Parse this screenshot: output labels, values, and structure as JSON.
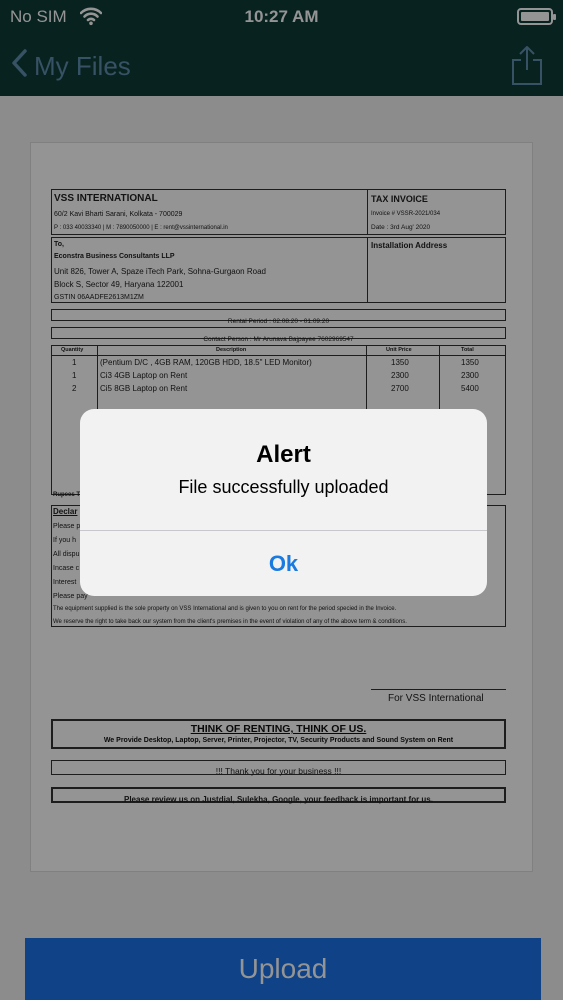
{
  "status_bar": {
    "carrier": "No SIM",
    "time": "10:27 AM"
  },
  "nav": {
    "back_label": "My Files"
  },
  "invoice": {
    "company": "VSS INTERNATIONAL",
    "company_address": "60/2 Kavi Bharti Sarani, Kolkata - 700029",
    "company_contact": "P : 033 40033340 | M : 7890050000 | E : rent@vssinternational.in",
    "doc_type": "TAX INVOICE",
    "invoice_no": "Invoice # VSSR-2021/034",
    "date": "Date : 3rd Aug' 2020",
    "to_label": "To,",
    "client_name": "Econstra Business Consultants LLP",
    "client_address_1": "Unit 826, Tower A, Spaze iTech Park, Sohna-Gurgaon Road",
    "client_address_2": "Block S, Sector 49, Haryana 122001",
    "client_gstin": "GSTIN 06AADFE2613M1ZM",
    "installation_label": "Installation Address",
    "rental_period": "Rental Period : 02.08.20 - 01.09.20",
    "contact_person": "Contact Person : Mr Arunava Bajpayee 7602969547",
    "columns": [
      "Quantity",
      "Description",
      "Unit Price",
      "Total"
    ],
    "rows": [
      {
        "qty": "1",
        "desc": "(Pentium D/C , 4GB RAM, 120GB HDD, 18.5\" LED Monitor)",
        "unit": "1350",
        "total": "1350"
      },
      {
        "qty": "1",
        "desc": "Ci3 4GB Laptop on Rent",
        "unit": "2300",
        "total": "2300"
      },
      {
        "qty": "2",
        "desc": "Ci5 8GB Laptop on Rent",
        "unit": "2700",
        "total": "5400"
      }
    ],
    "rupees_label": "Rupees T",
    "decl_title": "Declar",
    "decl_lines": [
      "Please p",
      "If you h",
      "All dispu",
      "Incase c",
      "Interest",
      "Please pay"
    ],
    "decl_full_1": "The equipment supplied is the sole property on VSS International and is given to you on rent for the period specied in the Invoice.",
    "decl_full_2": "We reserve the right to take back our system from the client's premises in the event of violation of any of the above term & conditions.",
    "for_vss": "For VSS International",
    "tag_title": "THINK OF RENTING, THINK OF US.",
    "tag_sub": "We Provide Desktop, Laptop, Server, Printer, Projector, TV, Security Products and Sound System on Rent",
    "thanks": "!!! Thank you for your business !!!",
    "review": "Please review us on Justdial, Sulekha, Google, your feedback is important for us."
  },
  "upload_label": "Upload",
  "alert": {
    "title": "Alert",
    "message": "File successfully uploaded",
    "ok_label": "Ok"
  },
  "colors": {
    "nav_bg": "#0e3b36",
    "button_blue": "#1a73e8",
    "alert_action": "#1a7ae0"
  },
  "icons": [
    "wifi-icon",
    "battery-icon",
    "back-chevron-icon",
    "share-icon"
  ]
}
